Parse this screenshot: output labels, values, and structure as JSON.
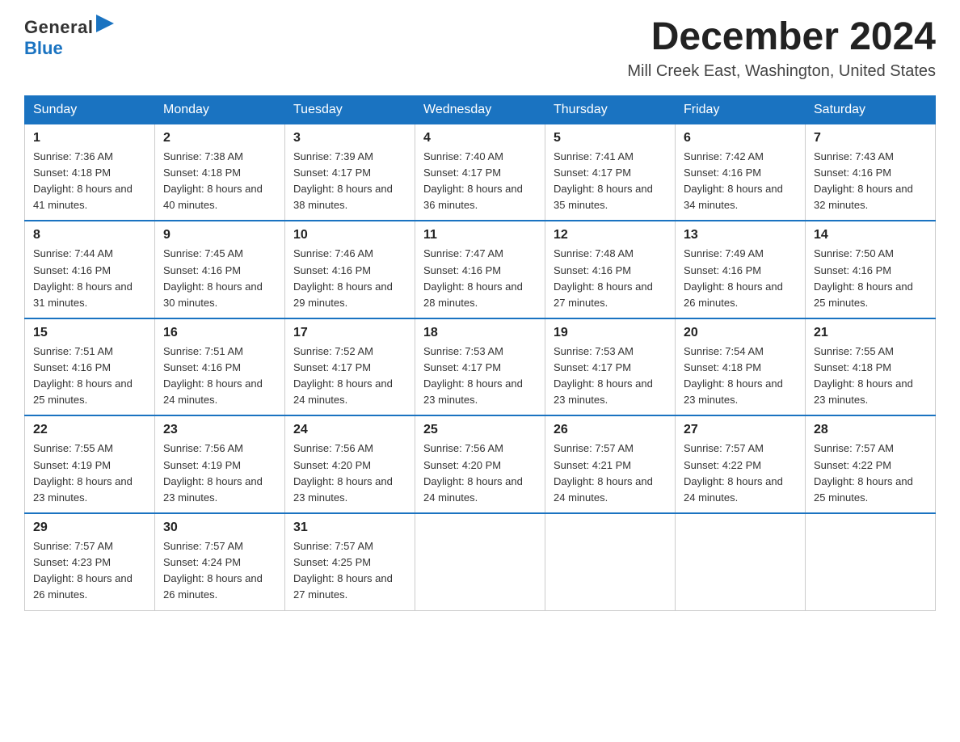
{
  "header": {
    "logo_general": "General",
    "logo_blue": "Blue",
    "month_title": "December 2024",
    "location": "Mill Creek East, Washington, United States"
  },
  "days_of_week": [
    "Sunday",
    "Monday",
    "Tuesday",
    "Wednesday",
    "Thursday",
    "Friday",
    "Saturday"
  ],
  "weeks": [
    [
      {
        "day": "1",
        "sunrise": "7:36 AM",
        "sunset": "4:18 PM",
        "daylight": "8 hours and 41 minutes."
      },
      {
        "day": "2",
        "sunrise": "7:38 AM",
        "sunset": "4:18 PM",
        "daylight": "8 hours and 40 minutes."
      },
      {
        "day": "3",
        "sunrise": "7:39 AM",
        "sunset": "4:17 PM",
        "daylight": "8 hours and 38 minutes."
      },
      {
        "day": "4",
        "sunrise": "7:40 AM",
        "sunset": "4:17 PM",
        "daylight": "8 hours and 36 minutes."
      },
      {
        "day": "5",
        "sunrise": "7:41 AM",
        "sunset": "4:17 PM",
        "daylight": "8 hours and 35 minutes."
      },
      {
        "day": "6",
        "sunrise": "7:42 AM",
        "sunset": "4:16 PM",
        "daylight": "8 hours and 34 minutes."
      },
      {
        "day": "7",
        "sunrise": "7:43 AM",
        "sunset": "4:16 PM",
        "daylight": "8 hours and 32 minutes."
      }
    ],
    [
      {
        "day": "8",
        "sunrise": "7:44 AM",
        "sunset": "4:16 PM",
        "daylight": "8 hours and 31 minutes."
      },
      {
        "day": "9",
        "sunrise": "7:45 AM",
        "sunset": "4:16 PM",
        "daylight": "8 hours and 30 minutes."
      },
      {
        "day": "10",
        "sunrise": "7:46 AM",
        "sunset": "4:16 PM",
        "daylight": "8 hours and 29 minutes."
      },
      {
        "day": "11",
        "sunrise": "7:47 AM",
        "sunset": "4:16 PM",
        "daylight": "8 hours and 28 minutes."
      },
      {
        "day": "12",
        "sunrise": "7:48 AM",
        "sunset": "4:16 PM",
        "daylight": "8 hours and 27 minutes."
      },
      {
        "day": "13",
        "sunrise": "7:49 AM",
        "sunset": "4:16 PM",
        "daylight": "8 hours and 26 minutes."
      },
      {
        "day": "14",
        "sunrise": "7:50 AM",
        "sunset": "4:16 PM",
        "daylight": "8 hours and 25 minutes."
      }
    ],
    [
      {
        "day": "15",
        "sunrise": "7:51 AM",
        "sunset": "4:16 PM",
        "daylight": "8 hours and 25 minutes."
      },
      {
        "day": "16",
        "sunrise": "7:51 AM",
        "sunset": "4:16 PM",
        "daylight": "8 hours and 24 minutes."
      },
      {
        "day": "17",
        "sunrise": "7:52 AM",
        "sunset": "4:17 PM",
        "daylight": "8 hours and 24 minutes."
      },
      {
        "day": "18",
        "sunrise": "7:53 AM",
        "sunset": "4:17 PM",
        "daylight": "8 hours and 23 minutes."
      },
      {
        "day": "19",
        "sunrise": "7:53 AM",
        "sunset": "4:17 PM",
        "daylight": "8 hours and 23 minutes."
      },
      {
        "day": "20",
        "sunrise": "7:54 AM",
        "sunset": "4:18 PM",
        "daylight": "8 hours and 23 minutes."
      },
      {
        "day": "21",
        "sunrise": "7:55 AM",
        "sunset": "4:18 PM",
        "daylight": "8 hours and 23 minutes."
      }
    ],
    [
      {
        "day": "22",
        "sunrise": "7:55 AM",
        "sunset": "4:19 PM",
        "daylight": "8 hours and 23 minutes."
      },
      {
        "day": "23",
        "sunrise": "7:56 AM",
        "sunset": "4:19 PM",
        "daylight": "8 hours and 23 minutes."
      },
      {
        "day": "24",
        "sunrise": "7:56 AM",
        "sunset": "4:20 PM",
        "daylight": "8 hours and 23 minutes."
      },
      {
        "day": "25",
        "sunrise": "7:56 AM",
        "sunset": "4:20 PM",
        "daylight": "8 hours and 24 minutes."
      },
      {
        "day": "26",
        "sunrise": "7:57 AM",
        "sunset": "4:21 PM",
        "daylight": "8 hours and 24 minutes."
      },
      {
        "day": "27",
        "sunrise": "7:57 AM",
        "sunset": "4:22 PM",
        "daylight": "8 hours and 24 minutes."
      },
      {
        "day": "28",
        "sunrise": "7:57 AM",
        "sunset": "4:22 PM",
        "daylight": "8 hours and 25 minutes."
      }
    ],
    [
      {
        "day": "29",
        "sunrise": "7:57 AM",
        "sunset": "4:23 PM",
        "daylight": "8 hours and 26 minutes."
      },
      {
        "day": "30",
        "sunrise": "7:57 AM",
        "sunset": "4:24 PM",
        "daylight": "8 hours and 26 minutes."
      },
      {
        "day": "31",
        "sunrise": "7:57 AM",
        "sunset": "4:25 PM",
        "daylight": "8 hours and 27 minutes."
      },
      null,
      null,
      null,
      null
    ]
  ]
}
